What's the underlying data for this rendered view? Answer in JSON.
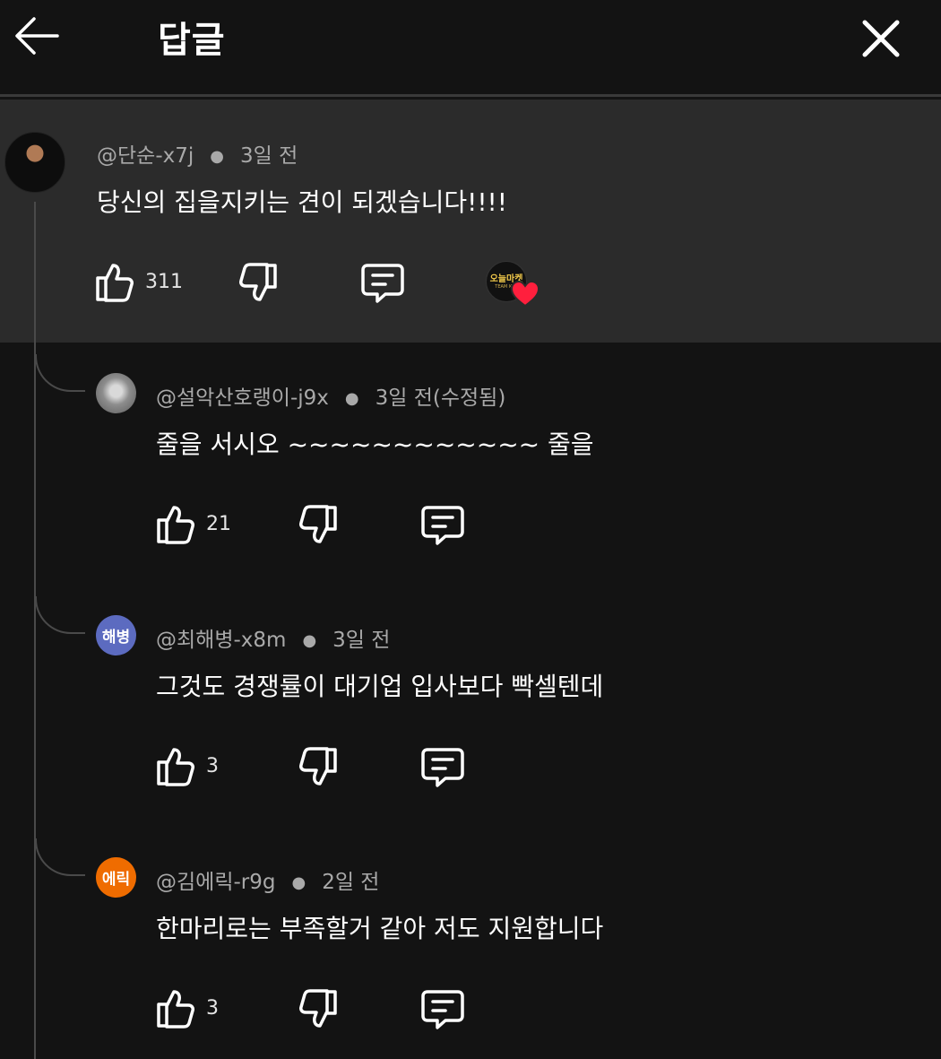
{
  "header": {
    "title": "답글",
    "back_icon": "arrow-left-icon",
    "close_icon": "close-icon"
  },
  "parent_comment": {
    "author": "@단순-x7j",
    "time": "3일 전",
    "text": "당신의 집을지키는 견이 되겠습니다!!!!",
    "likes": "311",
    "creator_badge": "오늘마켓",
    "creator_badge_sub": "TEAM KEV"
  },
  "replies": [
    {
      "author": "@설악산호랭이-j9x",
      "time": "3일 전(수정됨)",
      "text": "줄을 서시오 ~~~~~~~~~~~~ 줄을",
      "likes": "21",
      "avatar_text": ""
    },
    {
      "author": "@최해병-x8m",
      "time": "3일 전",
      "text": "그것도 경쟁률이 대기업 입사보다 빡셀텐데",
      "likes": "3",
      "avatar_text": "해병"
    },
    {
      "author": "@김에릭-r9g",
      "time": "2일 전",
      "text": "한마리로는 부족할거 같아 저도 지원합니다",
      "likes": "3",
      "avatar_text": "에릭"
    }
  ],
  "colors": {
    "background": "#131313",
    "parent_background": "#2b2b2b",
    "heart": "#ff1f3d",
    "avatar_purple": "#5c6bc0",
    "avatar_orange": "#ef6c00"
  }
}
